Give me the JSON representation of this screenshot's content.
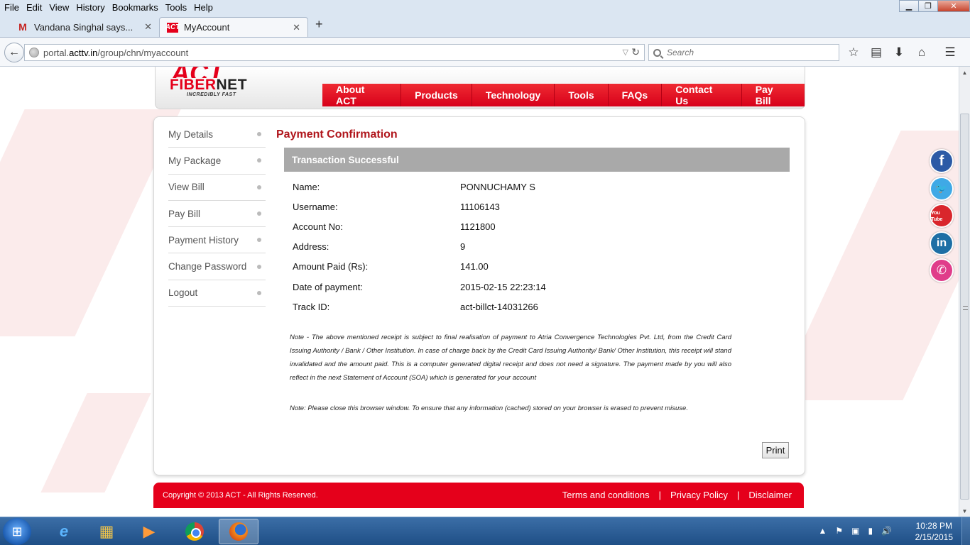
{
  "browser": {
    "menu": [
      "File",
      "Edit",
      "View",
      "History",
      "Bookmarks",
      "Tools",
      "Help"
    ],
    "tabs": [
      {
        "label": "Vandana Singhal says...",
        "icon": "gmail-icon"
      },
      {
        "label": "MyAccount",
        "icon": "act-favicon"
      }
    ],
    "url_prefix": "portal.",
    "url_domain": "acttv.in",
    "url_path": "/group/chn/myaccount",
    "search_placeholder": "Search",
    "glyphs": {
      "back": "←",
      "reload": "↻",
      "dropdown": "▽",
      "newtab": "+",
      "close": "✕",
      "minimize": "▁",
      "maximize": "❐",
      "win_close": "✕",
      "bookmark_star": "☆",
      "reader": "▤",
      "download": "⬇",
      "home": "⌂",
      "menu": "☰"
    }
  },
  "site": {
    "logo": {
      "act": "ACT",
      "fiber_prefix": "F",
      "fiber_bolt": "I",
      "fiber_mid": "BER",
      "fiber_net": "NET",
      "tagline": "INCREDIBLY FAST"
    },
    "nav": [
      "About ACT",
      "Products",
      "Technology",
      "Tools",
      "FAQs",
      "Contact Us",
      "Pay Bill"
    ],
    "sidemenu": [
      "My Details",
      "My Package",
      "View Bill",
      "Pay Bill",
      "Payment History",
      "Change Password",
      "Logout"
    ],
    "page_title": "Payment Confirmation",
    "status": "Transaction Successful",
    "details": [
      {
        "label": "Name:",
        "value": "PONNUCHAMY S"
      },
      {
        "label": "Username:",
        "value": "11106143"
      },
      {
        "label": "Account No:",
        "value": "1121800"
      },
      {
        "label": "Address:",
        "value": "9"
      },
      {
        "label": "Amount Paid (Rs):",
        "value": "141.00"
      },
      {
        "label": "Date of payment:",
        "value": "2015-02-15 22:23:14"
      },
      {
        "label": "Track ID:",
        "value": "act-billct-14031266"
      }
    ],
    "note1": "Note - The above mentioned receipt is subject to final realisation of payment to Atria Convergence Technologies Pvt. Ltd, from the Credit Card Issuing Authority / Bank / Other Institution. In case of charge back by the Credit Card Issuing Authority/ Bank/ Other Institution, this receipt will stand invalidated and the amount paid. This is a computer generated digital receipt and does not need a signature. The payment made by you will also reflect in the next Statement of Account (SOA) which is generated for your account",
    "note2": "Note: Please close this browser window. To ensure that any information (cached) stored on your browser is erased to prevent misuse.",
    "print_label": "Print",
    "footer": {
      "copyright": "Copyright © 2013 ACT - All Rights Reserved.",
      "links": [
        "Terms and conditions",
        "Privacy Policy",
        "Disclaimer"
      ],
      "separator": "|"
    },
    "social": [
      {
        "name": "facebook-icon",
        "glyph": "f"
      },
      {
        "name": "twitter-icon",
        "glyph": "🐦"
      },
      {
        "name": "youtube-icon",
        "glyph": "You Tube"
      },
      {
        "name": "linkedin-icon",
        "glyph": "in"
      },
      {
        "name": "phone-icon",
        "glyph": "✆"
      }
    ],
    "colors": {
      "brand_red": "#e5001b",
      "title_red": "#b0161c",
      "status_bar": "#a9a9a9"
    }
  },
  "taskbar": {
    "time": "10:28 PM",
    "date": "2/15/2015",
    "apps": [
      "internet-explorer-icon",
      "file-explorer-icon",
      "media-player-icon",
      "chrome-icon",
      "firefox-icon"
    ],
    "glyphs": {
      "start": "⊞",
      "ie": "e",
      "explorer": "▦",
      "media": "▶",
      "tray_arrow": "▲",
      "flag": "⚑",
      "device": "▣",
      "signal": "▮",
      "volume": "🔊"
    }
  }
}
